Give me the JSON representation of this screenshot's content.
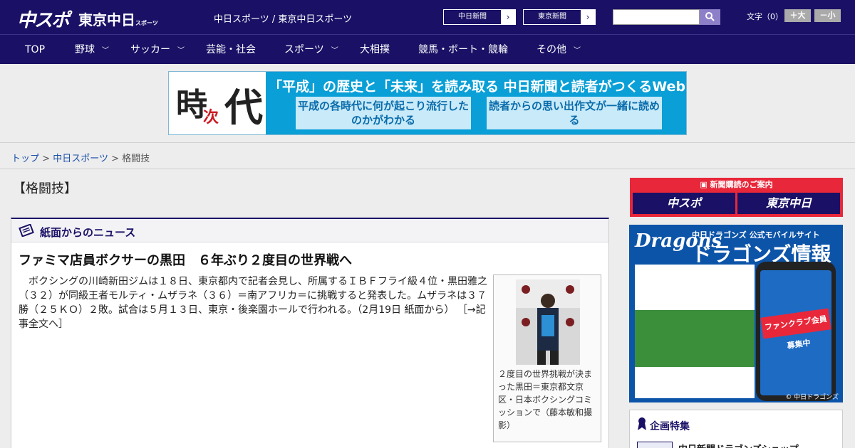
{
  "header": {
    "logo_chuspo": "中スポ",
    "logo_tokyo": "東京中日",
    "logo_tokyo_suffix": "スポーツ",
    "site_title": "中日スポーツ / 東京中日スポーツ",
    "ext_links": [
      {
        "label": "中日新聞"
      },
      {
        "label": "東京新聞"
      }
    ],
    "search": {
      "placeholder": "",
      "value": ""
    },
    "font_size_label": "文字（0）",
    "font_bigger": "＋大",
    "font_smaller": "－小"
  },
  "nav": [
    {
      "label": "TOP",
      "has_menu": false
    },
    {
      "label": "野球",
      "has_menu": true
    },
    {
      "label": "サッカー",
      "has_menu": true
    },
    {
      "label": "芸能・社会",
      "has_menu": false
    },
    {
      "label": "スポーツ",
      "has_menu": true
    },
    {
      "label": "大相撲",
      "has_menu": false
    },
    {
      "label": "競馬・ボート・競輪",
      "has_menu": false
    },
    {
      "label": "その他",
      "has_menu": true
    }
  ],
  "banner": {
    "kanji_ji": "時",
    "kanji_tsugi": "次",
    "kanji_dai": "代",
    "headline": "「平成」の歴史と「未来」を読み取る  中日新聞と読者がつくるWebサイト",
    "box_left": "平成の各時代に何が起こり流行したのかがわかる",
    "box_right": "読者からの思い出作文が一緒に読める"
  },
  "breadcrumb": {
    "home": "トップ",
    "sep": ">",
    "parent": "中日スポーツ",
    "current": "格闘技"
  },
  "section_title": "【格闘技】",
  "news": {
    "panel_title": "紙面からのニュース",
    "article_title": "ファミマ店員ボクサーの黒田　６年ぶり２度目の世界戦へ",
    "article_body": "ボクシングの川崎新田ジムは１８日、東京都内で記者会見し、所属するＩＢＦフライ級４位・黒田雅之（３２）が同級王者モルティ・ムザラネ（３６）＝南アフリカ＝に挑戦すると発表した。ムザラネは３７勝（２５ＫＯ）２敗。試合は５月１３日、東京・後楽園ホールで行われる。（2月19日 紙面から）",
    "read_more": "［→記事全文へ］",
    "photo_caption": "２度目の世界挑戦が決まった黒田＝東京都文京区・日本ボクシングコミッションで（藤本敏和撮影）"
  },
  "sidebar": {
    "subscribe_header": "新聞購読のご案内",
    "subscribe_logos": [
      "中スポ",
      "東京中日"
    ],
    "dragons_brand": "Dragons",
    "dragons_sub": "中日ドラゴンズ  公式モバイルサイト",
    "dragons_big": "ドラゴンズ情報",
    "dragons_phone_banner": "ファンクラブ会員募集中",
    "dragons_copyright": "© 中日ドラゴンズ",
    "special_title": "企画特集",
    "special_item": "中日新聞ドラゴンズショップ"
  },
  "colors": {
    "brand_navy": "#1a1166",
    "link_blue": "#1a4fa8",
    "subscribe_red": "#e8283a",
    "banner_blue": "#0a9fd6"
  }
}
